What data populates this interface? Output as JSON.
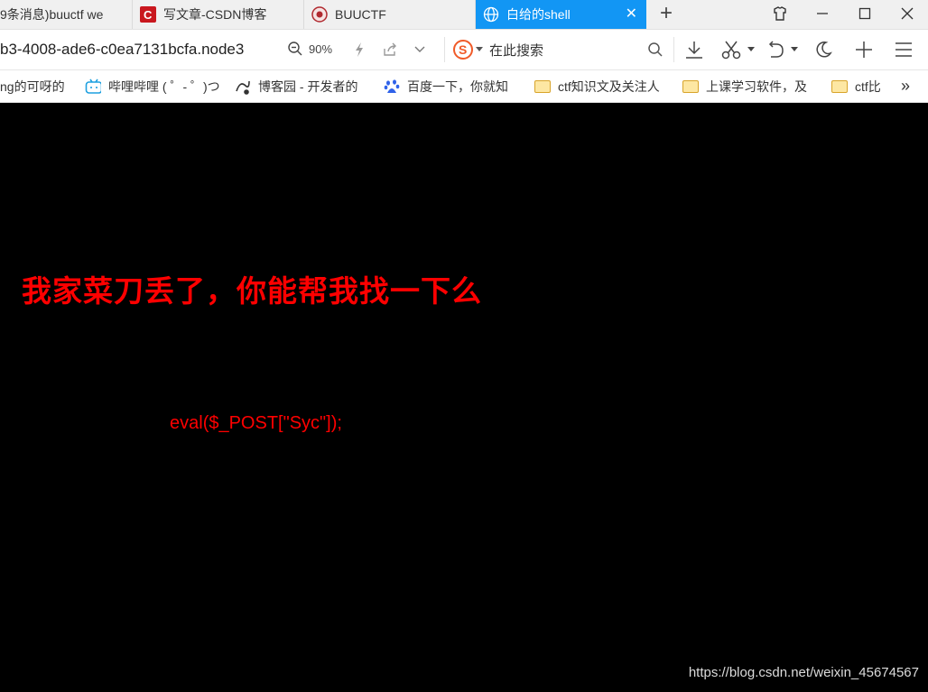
{
  "tabs": [
    {
      "title": "9条消息)buuctf we"
    },
    {
      "title": "写文章-CSDN博客"
    },
    {
      "title": "BUUCTF"
    },
    {
      "title": "白给的shell",
      "active": true
    }
  ],
  "address": {
    "url": "b3-4008-ade6-c0ea7131bcfa.node3",
    "zoom": "90%",
    "search_placeholder": "在此搜索"
  },
  "bookmarks": [
    {
      "label": "ng的可呀的"
    },
    {
      "label": "哔哩哔哩 ( ゜- ゜)つ"
    },
    {
      "label": "博客园 - 开发者的"
    },
    {
      "label": "百度一下，你就知"
    },
    {
      "label": "ctf知识文及关注人"
    },
    {
      "label": "上课学习软件，及"
    },
    {
      "label": "ctf比"
    }
  ],
  "page": {
    "heading": "我家菜刀丢了，你能帮我找一下么",
    "code": "eval($_POST[\"Syc\"]);",
    "watermark": "https://blog.csdn.net/weixin_45674567"
  },
  "colors": {
    "accent": "#1296f4",
    "text_red": "#ff0000",
    "page_bg": "#000000"
  }
}
